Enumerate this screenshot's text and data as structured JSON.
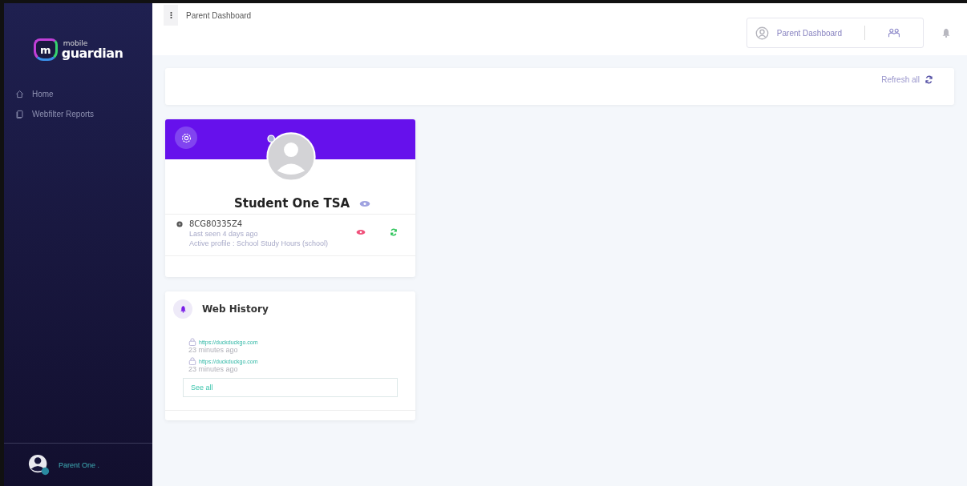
{
  "brand": {
    "mark": "m",
    "line_1": "mobile",
    "line_2": "guardian"
  },
  "sidebar": {
    "items": [
      {
        "label": "Home"
      },
      {
        "label": "Webfilter Reports"
      }
    ],
    "user": "Parent One ."
  },
  "header": {
    "title": "Parent Dashboard",
    "profile_label": "Parent Dashboard"
  },
  "refresh": {
    "label": "Refresh all"
  },
  "student": {
    "name": "Student One TSA",
    "device_id": "8CG80335Z4",
    "last_seen": "Last seen 4 days ago",
    "active_profile": "Active profile : School Study Hours (school)"
  },
  "web_history": {
    "title": "Web History",
    "entries": [
      {
        "url": "https://duckduckgo.com",
        "time": "23 minutes ago"
      },
      {
        "url": "https://duckduckgo.com",
        "time": "23 minutes ago"
      }
    ],
    "see_all": "See all"
  }
}
